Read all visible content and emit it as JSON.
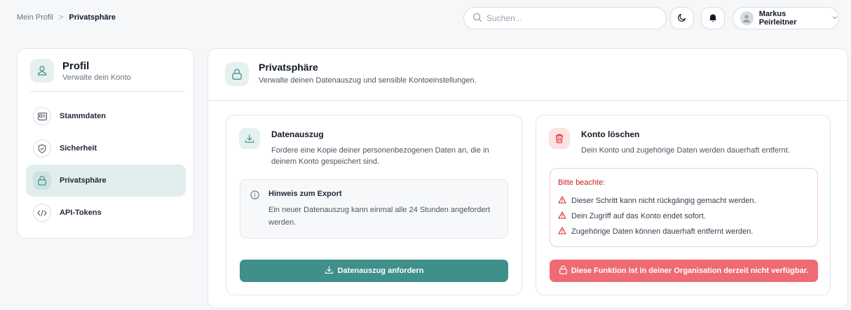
{
  "breadcrumb": {
    "parent": "Mein Profil",
    "separator": ">",
    "current": "Privatsphäre"
  },
  "search": {
    "placeholder": "Suchen..."
  },
  "user": {
    "name": "Markus Peirleitner"
  },
  "sidebar": {
    "title": "Profil",
    "subtitle": "Verwalte dein Konto",
    "items": [
      {
        "label": "Stammdaten",
        "icon": "id-card-icon"
      },
      {
        "label": "Sicherheit",
        "icon": "shield-icon"
      },
      {
        "label": "Privatsphäre",
        "icon": "lock-icon",
        "active": true
      },
      {
        "label": "API-Tokens",
        "icon": "code-icon"
      }
    ]
  },
  "main": {
    "title": "Privatsphäre",
    "subtitle": "Verwalte deinen Datenauszug und sensible Kontoeinstellungen."
  },
  "export": {
    "title": "Datenauszug",
    "description": "Fordere eine Kopie deiner personenbezogenen Daten an, die in deinem Konto gespeichert sind.",
    "note_title": "Hinweis zum Export",
    "note_text": "Ein neuer Datenauszug kann einmal alle 24 Stunden angefordert werden.",
    "button_label": "Datenauszug anfordern"
  },
  "delete": {
    "title": "Konto löschen",
    "description": "Dein Konto und zugehörige Daten werden dauerhaft entfernt.",
    "warning_title": "Bitte beachte:",
    "warnings": [
      "Dieser Schritt kann nicht rückgängig gemacht werden.",
      "Dein Zugriff auf das Konto endet sofort.",
      "Zugehörige Daten können dauerhaft entfernt werden."
    ],
    "button_label": "Diese Funktion ist in deiner Organisation derzeit nicht verfügbar."
  },
  "colors": {
    "accent": "#3f8f8a",
    "danger": "#ef6b74",
    "danger_text": "#c81e1e",
    "active_bg": "#e2eeee"
  }
}
